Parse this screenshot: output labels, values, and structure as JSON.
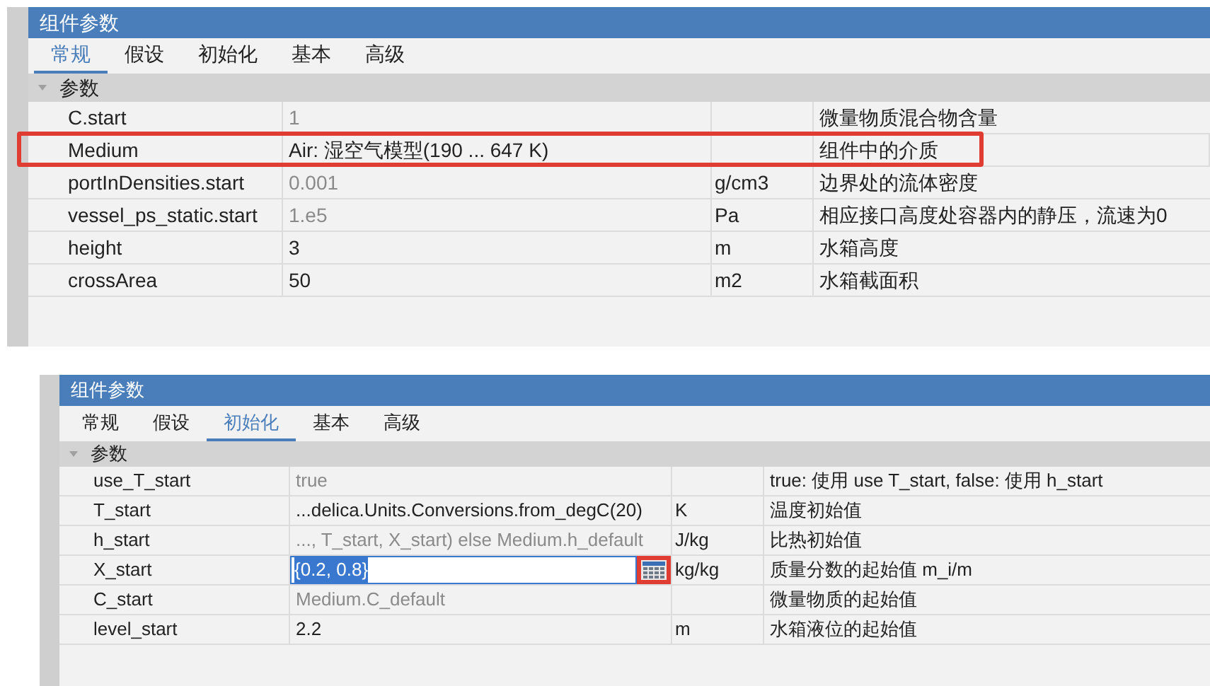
{
  "panels": [
    {
      "title": "组件参数",
      "tabs": [
        {
          "label": "常规",
          "selected": true
        },
        {
          "label": "假设",
          "selected": false
        },
        {
          "label": "初始化",
          "selected": false
        },
        {
          "label": "基本",
          "selected": false
        },
        {
          "label": "高级",
          "selected": false
        }
      ],
      "group": {
        "label": "参数",
        "expanded": true
      },
      "rows": [
        {
          "name": "C.start",
          "value": "1",
          "value_default": true,
          "unit": "",
          "description": "微量物质混合物含量",
          "highlighted": false
        },
        {
          "name": "Medium",
          "value": "Air: 湿空气模型(190 ... 647 K)",
          "value_default": false,
          "unit": "",
          "description": "组件中的介质",
          "highlighted": true
        },
        {
          "name": "portInDensities.start",
          "value": "0.001",
          "value_default": true,
          "unit": "g/cm3",
          "description": "边界处的流体密度",
          "highlighted": false
        },
        {
          "name": "vessel_ps_static.start",
          "value": "1.e5",
          "value_default": true,
          "unit": "Pa",
          "description": "相应接口高度处容器内的静压，流速为0",
          "highlighted": false
        },
        {
          "name": "height",
          "value": "3",
          "value_default": false,
          "unit": "m",
          "description": "水箱高度",
          "highlighted": false
        },
        {
          "name": "crossArea",
          "value": "50",
          "value_default": false,
          "unit": "m2",
          "description": "水箱截面积",
          "highlighted": false
        }
      ]
    },
    {
      "title": "组件参数",
      "tabs": [
        {
          "label": "常规",
          "selected": false
        },
        {
          "label": "假设",
          "selected": false
        },
        {
          "label": "初始化",
          "selected": true
        },
        {
          "label": "基本",
          "selected": false
        },
        {
          "label": "高级",
          "selected": false
        }
      ],
      "group": {
        "label": "参数",
        "expanded": true
      },
      "rows": [
        {
          "name": "use_T_start",
          "value": "true",
          "value_default": true,
          "unit": "",
          "description": "true: 使用 use T_start, false: 使用 h_start"
        },
        {
          "name": "T_start",
          "value": "...delica.Units.Conversions.from_degC(20)",
          "value_default": false,
          "unit": "K",
          "description": "温度初始值"
        },
        {
          "name": "h_start",
          "value": "..., T_start, X_start) else Medium.h_default",
          "value_default": true,
          "unit": "J/kg",
          "description": "比热初始值"
        },
        {
          "name": "X_start",
          "kind": "editing",
          "value": "{0.2, 0.8}",
          "value_default": false,
          "unit": "kg/kg",
          "description": "质量分数的起始值 m_i/m",
          "button_highlighted": true
        },
        {
          "name": "C_start",
          "value": "Medium.C_default",
          "value_default": true,
          "unit": "",
          "description": "微量物质的起始值"
        },
        {
          "name": "level_start",
          "value": "2.2",
          "value_default": false,
          "unit": "m",
          "description": "水箱液位的起始值"
        }
      ]
    }
  ]
}
